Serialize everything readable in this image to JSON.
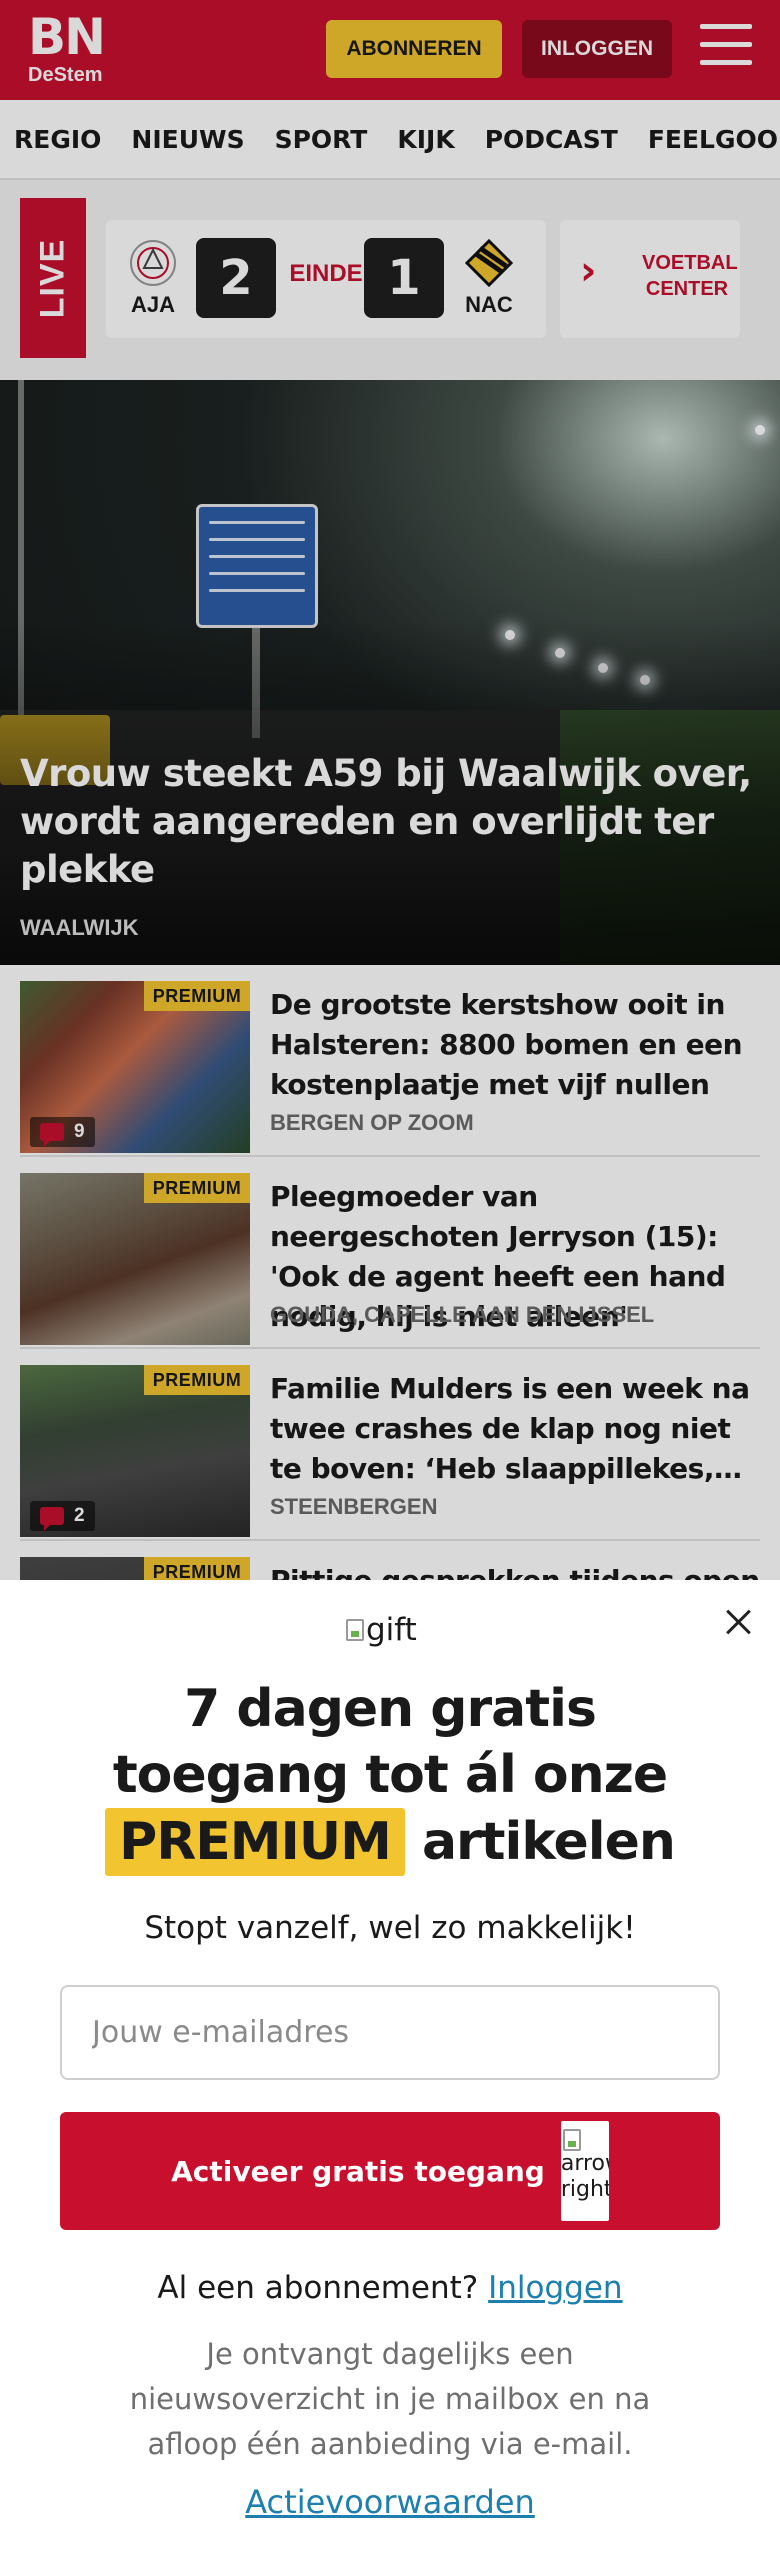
{
  "header": {
    "logo_main": "BN",
    "logo_sub": "DeStem",
    "subscribe_label": "ABONNEREN",
    "login_label": "INLOGGEN",
    "accent_color": "#c8102e",
    "subscribe_color": "#f2c530"
  },
  "nav": {
    "items": [
      "REGIO",
      "NIEUWS",
      "SPORT",
      "KIJK",
      "PODCAST",
      "FEELGOOD"
    ]
  },
  "live": {
    "badge": "LIVE",
    "match": {
      "home_code": "AJA",
      "home_score": "2",
      "status": "EINDE",
      "away_score": "1",
      "away_code": "NAC"
    },
    "voetbal_center": "VOETBAL CENTER"
  },
  "hero": {
    "title": "Vrouw steekt A59 bij Waalwijk over, wordt aangereden en overlijdt ter plekke",
    "location": "WAALWIJK"
  },
  "articles": [
    {
      "premium": "PREMIUM",
      "comments": "9",
      "title": "De grootste kerstshow ooit in Halsteren: 8800 bomen en een kostenplaatje met vijf nullen",
      "location": "BERGEN OP ZOOM"
    },
    {
      "premium": "PREMIUM",
      "title": "Pleegmoeder van neergeschoten Jerryson (15): 'Ook de agent heeft een hand nodig, hij is niet alleen'",
      "location": "GOUDA, CAPELLE AAN DEN IJSSEL"
    },
    {
      "premium": "PREMIUM",
      "comments": "2",
      "title": "Familie Mulders is een week na twee crashes de klap nog niet te boven: ‘Heb slaappillekes, ande…",
      "location": "STEENBERGEN"
    },
    {
      "premium": "PREMIUM",
      "title": "Pittige gesprekken tijdens open"
    }
  ],
  "modal": {
    "gift_alt": "gift",
    "title_line1": "7 dagen gratis",
    "title_line2": "toegang tot ál onze",
    "title_highlight": "PREMIUM",
    "title_line3_rest": "artikelen",
    "subtitle": "Stopt vanzelf, wel zo makkelijk!",
    "email_placeholder": "Jouw e-mailadres",
    "cta_label": "Activeer gratis toegang",
    "cta_arrow_alt": "arrow-right",
    "existing_text": "Al een abonnement?",
    "existing_link": "Inloggen",
    "disclaimer": "Je ontvangt dagelijks een nieuwsoverzicht in je mailbox en na afloop één aanbieding via e-mail.",
    "terms_link": "Actievoorwaarden"
  }
}
